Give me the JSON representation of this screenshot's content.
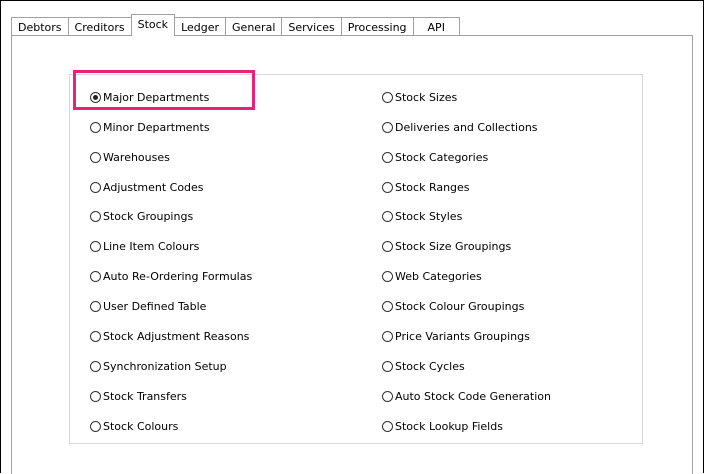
{
  "tabs": [
    {
      "label": "Debtors",
      "active": false
    },
    {
      "label": "Creditors",
      "active": false
    },
    {
      "label": "Stock",
      "active": true
    },
    {
      "label": "Ledger",
      "active": false
    },
    {
      "label": "General",
      "active": false
    },
    {
      "label": "Services",
      "active": false
    },
    {
      "label": "Processing",
      "active": false
    },
    {
      "label": "API",
      "active": false
    }
  ],
  "options": {
    "left": [
      {
        "label": "Major Departments",
        "checked": true
      },
      {
        "label": "Minor Departments",
        "checked": false
      },
      {
        "label": "Warehouses",
        "checked": false
      },
      {
        "label": "Adjustment Codes",
        "checked": false
      },
      {
        "label": "Stock Groupings",
        "checked": false
      },
      {
        "label": "Line Item Colours",
        "checked": false
      },
      {
        "label": "Auto Re-Ordering Formulas",
        "checked": false
      },
      {
        "label": "User Defined Table",
        "checked": false
      },
      {
        "label": "Stock Adjustment Reasons",
        "checked": false
      },
      {
        "label": "Synchronization Setup",
        "checked": false
      },
      {
        "label": "Stock Transfers",
        "checked": false
      },
      {
        "label": "Stock Colours",
        "checked": false
      }
    ],
    "right": [
      {
        "label": "Stock Sizes",
        "checked": false
      },
      {
        "label": "Deliveries and Collections",
        "checked": false
      },
      {
        "label": "Stock Categories",
        "checked": false
      },
      {
        "label": "Stock Ranges",
        "checked": false
      },
      {
        "label": "Stock Styles",
        "checked": false
      },
      {
        "label": "Stock Size Groupings",
        "checked": false
      },
      {
        "label": "Web Categories",
        "checked": false
      },
      {
        "label": "Stock Colour Groupings",
        "checked": false
      },
      {
        "label": "Price Variants Groupings",
        "checked": false
      },
      {
        "label": "Stock Cycles",
        "checked": false
      },
      {
        "label": "Auto Stock Code Generation",
        "checked": false
      },
      {
        "label": "Stock Lookup Fields",
        "checked": false
      }
    ]
  },
  "colors": {
    "highlight": "#e8207e",
    "tab_border": "#a0a0a0",
    "group_border": "#d8d8d8"
  }
}
